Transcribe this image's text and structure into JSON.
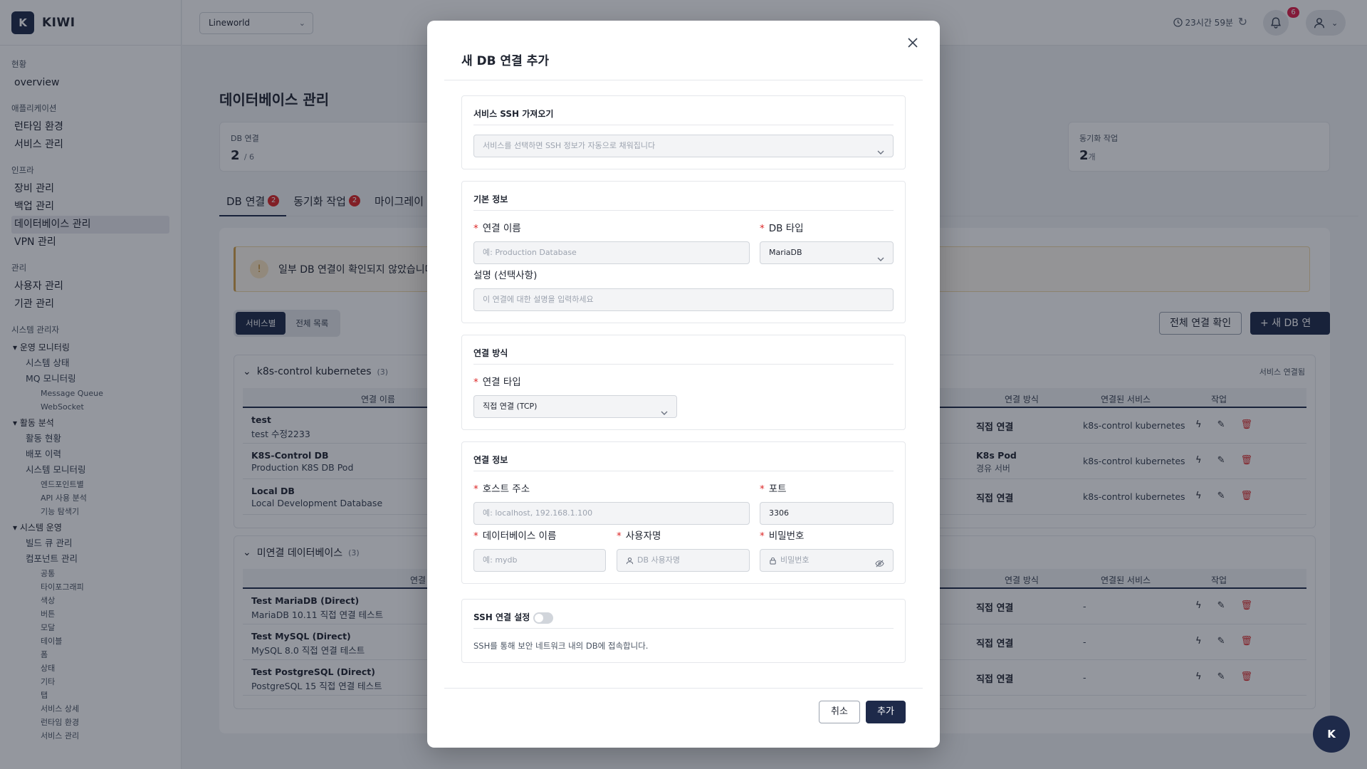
{
  "brand": {
    "logo": "K",
    "name": "KIWI"
  },
  "sidebar": {
    "sections": [
      {
        "title": "현황",
        "items": [
          "overview"
        ]
      },
      {
        "title": "애플리케이션",
        "items": [
          "런타임 환경",
          "서비스 관리"
        ]
      },
      {
        "title": "인프라",
        "items": [
          "장비 관리",
          "백업 관리",
          "데이터베이스 관리",
          "VPN 관리"
        ]
      },
      {
        "title": "관리",
        "items": [
          "사용자 관리",
          "기관 관리"
        ]
      },
      {
        "title": "시스템 관리자"
      }
    ],
    "groups": {
      "ops_monitoring": "운영 모니터링",
      "system_status": "시스템 상태",
      "mq_monitoring": "MQ 모니터링",
      "message_queue": "Message Queue",
      "websocket": "WebSocket",
      "activity_analysis": "활동 분석",
      "activity_status": "활동 현황",
      "deploy_history": "배포 이력",
      "system_monitoring": "시스템 모니터링",
      "endpoint": "엔드포인트별",
      "api_usage": "API 사용 분석",
      "feature_explorer": "기능 탐색기",
      "system_ops": "시스템 운영",
      "build_queue": "빌드 큐 관리",
      "component_mgmt": "컴포넌트 관리",
      "components": [
        "공통",
        "타이포그래피",
        "색상",
        "버튼",
        "모달",
        "테이블",
        "폼",
        "상태",
        "기타",
        "탭",
        "서비스 상세",
        "런타임 환경",
        "서비스 관리"
      ]
    }
  },
  "header": {
    "org_select": "Lineworld",
    "session_timer": "23시간 59분",
    "notification_count": "6",
    "icons": {
      "clock": "clock-icon",
      "refresh": "refresh-icon",
      "bell": "bell-icon",
      "user": "user-icon"
    }
  },
  "page": {
    "title": "데이터베이스 관리",
    "stats": [
      {
        "label": "DB 연결",
        "value": "2",
        "unit": "/ 6"
      },
      {
        "label": "동기화 작업",
        "value": "2",
        "unit": "개"
      }
    ],
    "tabs": [
      {
        "label": "DB 연결",
        "badge": "2"
      },
      {
        "label": "동기화 작업",
        "badge": "2"
      },
      {
        "label": "마이그레이"
      }
    ],
    "alert": "일부 DB 연결이 확인되지 않았습니다",
    "view_toggle": [
      "서비스별",
      "전체 목록"
    ],
    "check_all_button": "전체 연결 확인",
    "add_button": "+ 새 DB 연결 추가",
    "groups": [
      {
        "name": "k8s-control kubernetes",
        "count": "(3)",
        "right_label": "서비스 연결됨",
        "columns": [
          "연결 이름",
          "연결 방식",
          "연결된 서비스",
          "작업"
        ],
        "rows": [
          {
            "name": "test",
            "desc": "test 수정2233",
            "method": "직접 연결",
            "method_sub": "",
            "service": "k8s-control kubernetes"
          },
          {
            "name": "K8S-Control DB",
            "desc": "Production K8S DB Pod",
            "method": "K8s Pod",
            "method_sub": "경유 서버",
            "service": "k8s-control kubernetes"
          },
          {
            "name": "Local DB",
            "desc": "Local Development Database",
            "method": "직접 연결",
            "method_sub": "",
            "service": "k8s-control kubernetes"
          }
        ]
      },
      {
        "name": "미연결 데이터베이스",
        "count": "(3)",
        "columns": [
          "연결",
          "연결 방식",
          "연결된 서비스",
          "작업"
        ],
        "rows": [
          {
            "name": "Test MariaDB (Direct)",
            "desc": "MariaDB 10.11 직접 연결 테스트",
            "method": "직접 연결",
            "service": "-"
          },
          {
            "name": "Test MySQL (Direct)",
            "desc": "MySQL 8.0 직접 연결 테스트",
            "method": "직접 연결",
            "service": "-"
          },
          {
            "name": "Test PostgreSQL (Direct)",
            "desc": "PostgreSQL 15 직접 연결 테스트",
            "method": "직접 연결",
            "service": "-"
          }
        ]
      }
    ]
  },
  "modal": {
    "title": "새 DB 연결 추가",
    "ssh_import": {
      "title": "서비스 SSH 가져오기",
      "placeholder": "서비스를 선택하면 SSH 정보가 자동으로 채워집니다"
    },
    "basic": {
      "title": "기본 정보",
      "name_label": "연결 이름",
      "name_placeholder": "예: Production Database",
      "db_type_label": "DB 타입",
      "db_type_value": "MariaDB",
      "desc_label": "설명 (선택사항)",
      "desc_placeholder": "이 연결에 대한 설명을 입력하세요"
    },
    "method": {
      "title": "연결 방식",
      "type_label": "연결 타입",
      "type_value": "직접 연결 (TCP)"
    },
    "conn": {
      "title": "연결 정보",
      "host_label": "호스트 주소",
      "host_placeholder": "예: localhost, 192.168.1.100",
      "port_label": "포트",
      "port_value": "3306",
      "db_label": "데이터베이스 이름",
      "db_placeholder": "예: mydb",
      "user_label": "사용자명",
      "user_placeholder": "DB 사용자명",
      "pw_label": "비밀번호",
      "pw_placeholder": "비밀번호"
    },
    "ssh": {
      "title": "SSH 연결 설정",
      "enabled": false,
      "help": "SSH를 통해 보안 네트워크 내의 DB에 접속합니다."
    },
    "cancel": "취소",
    "submit": "추가"
  },
  "fab": "K"
}
